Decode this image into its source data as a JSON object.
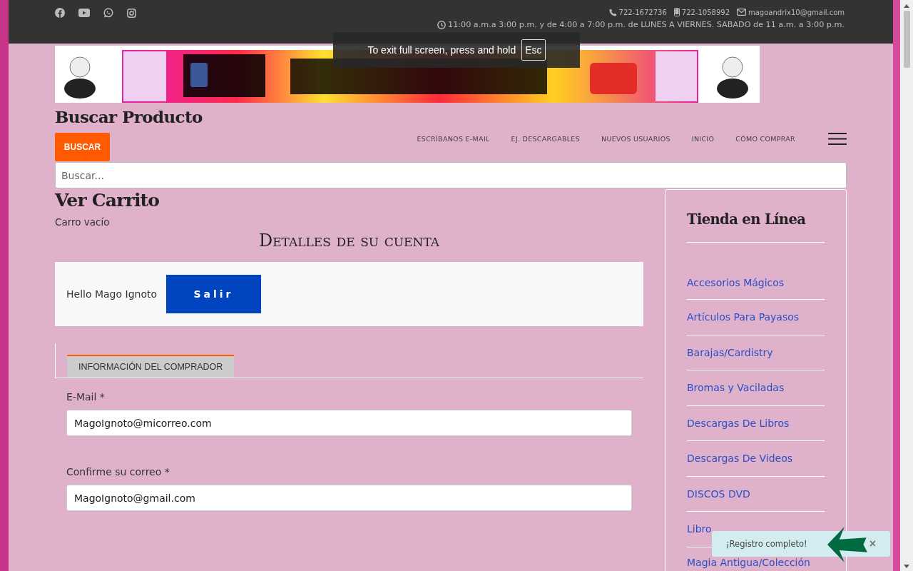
{
  "top_bar": {
    "social": [
      {
        "kind": "facebook"
      },
      {
        "kind": "youtube"
      },
      {
        "kind": "whatsapp"
      },
      {
        "kind": "instagram"
      }
    ],
    "contacts": [
      {
        "kind": "phone",
        "text": "722-1672736"
      },
      {
        "kind": "mobile",
        "text": "722-1058992"
      },
      {
        "kind": "mail",
        "text": "magoandrix10@gmail.com"
      }
    ],
    "hours": "11:00 a.m.a 3:00 p.m. y de 4:00 a 7:00 p.m. de LUNES A VIERNES. SABADO de 11 a.m. a 3:00 p.m."
  },
  "fullscreen_notice": {
    "text": "To exit full screen, press and hold",
    "key": "Esc"
  },
  "search": {
    "title": "Buscar Producto",
    "button": "BUSCAR",
    "placeholder": "Buscar..."
  },
  "nav": {
    "items": [
      "ESCRÍBANOS E-MAIL",
      "EJ. DESCARGABLES",
      "NUEVOS USUARIOS",
      "INICIO",
      "CÓMO COMPRAR"
    ]
  },
  "cart": {
    "title": "Ver Carrito",
    "status": "Carro vacío"
  },
  "account": {
    "title": "Detalles de su cuenta",
    "greeting": "Hello Mago Ignoto",
    "logout": "Salir"
  },
  "tabs": [
    {
      "label": "INFORMACIÓN DEL COMPRADOR",
      "selected": true
    }
  ],
  "fields": [
    {
      "label": "E-Mail *",
      "value": "MagoIgnoto@micorreo.com"
    },
    {
      "label": "Confirme su correo *",
      "value": "MagoIgnoto@gmail.com"
    }
  ],
  "sidebar": {
    "title": "Tienda en Línea",
    "items": [
      "Accesorios Mágicos",
      "Artículos Para Payasos",
      "Barajas/Cardistry",
      "Bromas y Vaciladas",
      "Descargas De Libros",
      "Descargas De Videos",
      "DISCOS DVD",
      "Libro",
      "Magia Antigua/Colección"
    ]
  },
  "toast": {
    "text": "¡Registro completo!",
    "close": "×"
  }
}
